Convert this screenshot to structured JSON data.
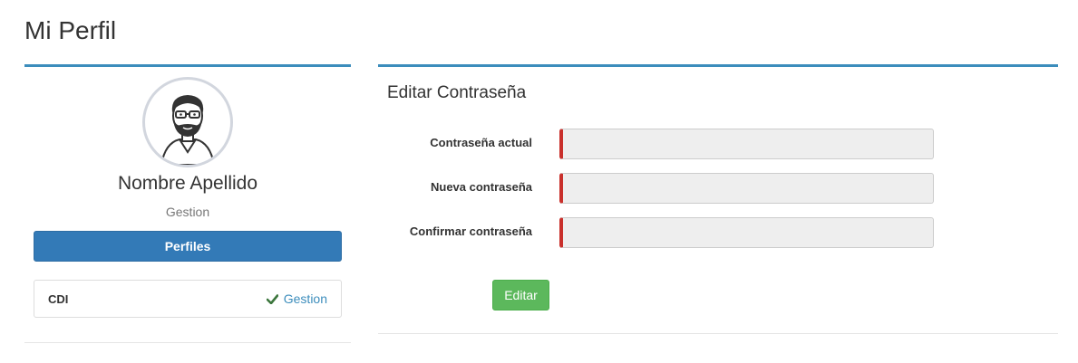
{
  "page": {
    "title": "Mi Perfil"
  },
  "profile": {
    "name": "Nombre Apellido",
    "role": "Gestion",
    "profiles_button": "Perfiles",
    "items": [
      {
        "code": "CDI",
        "status_icon": "check-icon",
        "link": "Gestion"
      }
    ]
  },
  "password_form": {
    "title": "Editar Contraseña",
    "fields": [
      {
        "label": "Contraseña actual",
        "value": ""
      },
      {
        "label": "Nueva contraseña",
        "value": ""
      },
      {
        "label": "Confirmar contraseña",
        "value": ""
      }
    ],
    "submit": "Editar"
  },
  "colors": {
    "box_accent": "#3c8dbc",
    "primary_button": "#337ab7",
    "success_button": "#5cb85c",
    "required_marker": "#c9302c",
    "check": "#3c763d"
  }
}
